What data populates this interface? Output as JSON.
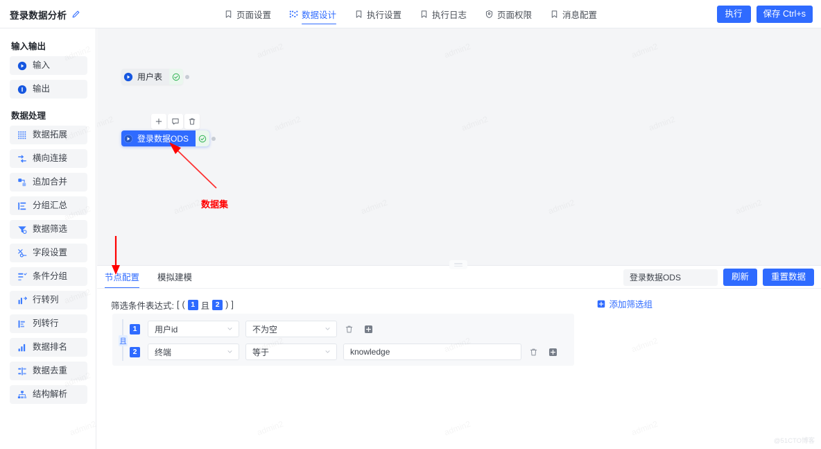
{
  "header": {
    "doc_title": "登录数据分析",
    "edit_icon": "pencil-icon",
    "tabs": [
      {
        "label": "页面设置",
        "icon": "bookmark-icon",
        "active": false
      },
      {
        "label": "数据设计",
        "icon": "nodes-icon",
        "active": true
      },
      {
        "label": "执行设置",
        "icon": "bookmark-icon",
        "active": false
      },
      {
        "label": "执行日志",
        "icon": "bookmark-icon",
        "active": false
      },
      {
        "label": "页面权限",
        "icon": "shield-icon",
        "active": false
      },
      {
        "label": "消息配置",
        "icon": "bookmark-icon",
        "active": false
      }
    ],
    "run_label": "执行",
    "save_label": "保存 Ctrl+s",
    "accent_color": "#2f6bff"
  },
  "sidebar": {
    "groups": [
      {
        "title": "输入输出",
        "items": [
          {
            "label": "输入",
            "icon": "play-circle-icon"
          },
          {
            "label": "输出",
            "icon": "info-circle-icon"
          }
        ]
      },
      {
        "title": "数据处理",
        "items": [
          {
            "label": "数据拓展",
            "icon": "grid-dots-icon"
          },
          {
            "label": "横向连接",
            "icon": "join-icon"
          },
          {
            "label": "追加合并",
            "icon": "append-merge-icon"
          },
          {
            "label": "分组汇总",
            "icon": "group-sum-icon"
          },
          {
            "label": "数据筛选",
            "icon": "filter-icon"
          },
          {
            "label": "字段设置",
            "icon": "field-settings-icon"
          },
          {
            "label": "条件分组",
            "icon": "condition-group-icon"
          },
          {
            "label": "行转列",
            "icon": "row-to-column-icon"
          },
          {
            "label": "列转行",
            "icon": "column-to-row-icon"
          },
          {
            "label": "数据排名",
            "icon": "rank-bars-icon"
          },
          {
            "label": "数据去重",
            "icon": "dedupe-icon"
          },
          {
            "label": "结构解析",
            "icon": "structure-parse-icon"
          }
        ]
      }
    ]
  },
  "canvas": {
    "watermark_text": "admin2",
    "nodes": [
      {
        "label": "用户表",
        "icon": "play-circle-icon",
        "status": "check-circle-icon",
        "selected": false
      },
      {
        "label": "登录数据ODS",
        "icon": "play-circle-icon",
        "status": "check-circle-icon",
        "selected": true
      }
    ],
    "node_toolbar": [
      {
        "name": "add-node-button",
        "icon": "plus-icon"
      },
      {
        "name": "comment-node-button",
        "icon": "comment-icon"
      },
      {
        "name": "delete-node-button",
        "icon": "trash-icon"
      }
    ],
    "annotation": {
      "text": "数据集",
      "color": "#ff0000"
    }
  },
  "bottom_panel": {
    "tabs": [
      {
        "label": "节点配置",
        "active": true
      },
      {
        "label": "模拟建模",
        "active": false
      }
    ],
    "dataset_name": "登录数据ODS",
    "refresh_label": "刷新",
    "reset_label": "重置数据",
    "expression": {
      "label": "筛选条件表达式:",
      "open_outer": "[",
      "open_inner": "(",
      "first": "1",
      "operator": "且",
      "second": "2",
      "close_inner": ")",
      "close_outer": "]"
    },
    "add_group_label": "添加筛选组",
    "add_group_icon": "plus-square-icon",
    "connector": "且",
    "conditions": [
      {
        "index": "1",
        "field": "用户id",
        "operator": "不为空",
        "value": null,
        "delete_icon": "trash-icon",
        "add_icon": "plus-square-icon"
      },
      {
        "index": "2",
        "field": "终端",
        "operator": "等于",
        "value": "knowledge",
        "delete_icon": "trash-icon",
        "add_icon": "plus-square-icon"
      }
    ]
  },
  "watermark_corner": "@51CTO博客"
}
